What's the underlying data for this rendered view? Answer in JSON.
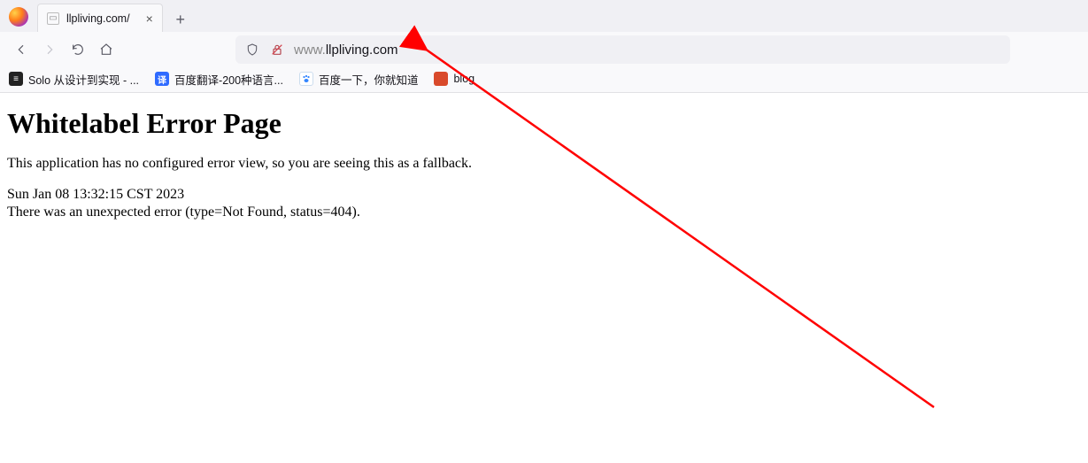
{
  "browser": {
    "tab": {
      "title": "llpliving.com/",
      "close": "×",
      "new": "+"
    },
    "url": {
      "proto_prefix": "www.",
      "host": "llpliving.com"
    },
    "bookmarks": [
      {
        "label": "Solo 从设计到实现 - ...",
        "icon_bg": "#222",
        "icon_txt": "≡"
      },
      {
        "label": "百度翻译-200种语言...",
        "icon_bg": "#2f6bff",
        "icon_txt": "译"
      },
      {
        "label": "百度一下，你就知道",
        "icon_bg": "#3385ff",
        "icon_txt": "",
        "paw": true
      },
      {
        "label": "blog",
        "icon_bg": "#d94a2b",
        "icon_txt": ""
      }
    ]
  },
  "page": {
    "heading": "Whitelabel Error Page",
    "subline": "This application has no configured error view, so you are seeing this as a fallback.",
    "timestamp": "Sun Jan 08 13:32:15 CST 2023",
    "error": "There was an unexpected error (type=Not Found, status=404)."
  }
}
